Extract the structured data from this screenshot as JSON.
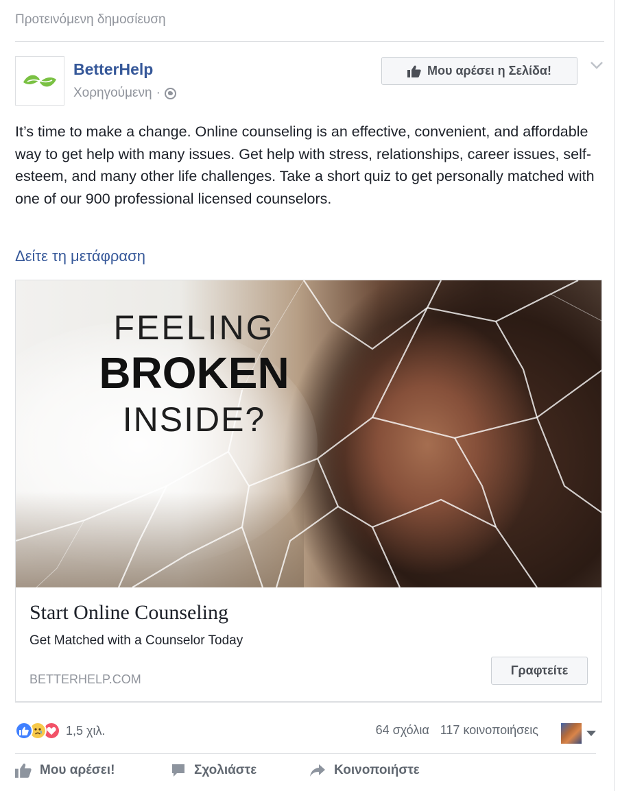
{
  "feed": {
    "suggested_label": "Προτεινόμενη δημοσίευση"
  },
  "post": {
    "page_name": "BetterHelp",
    "sponsored_label": "Χορηγούμενη",
    "separator": "·",
    "like_page_button": "Μου αρέσει η Σελίδα!",
    "body_text": "It’s time to make a change. Online counseling is an effective, convenient, and affordable way to get help with many issues. Get help with stress, relationships, career issues, self-esteem, and many other life challenges. Take a short quiz to get personally matched with one of our 900 professional licensed counselors.",
    "see_translation": "Δείτε τη μετάφραση",
    "brand_color": "#7ac143",
    "link_color": "#365899"
  },
  "ad_card": {
    "image_headline": {
      "line1": "FEELING",
      "line2": "BROKEN",
      "line3": "INSIDE?"
    },
    "title": "Start Online Counseling",
    "subtitle": "Get Matched with a Counselor Today",
    "domain": "BETTERHELP.COM",
    "cta_button": "Γραφτείτε"
  },
  "engagement": {
    "reaction_icons": [
      "like-reaction-icon",
      "sad-reaction-icon",
      "love-reaction-icon"
    ],
    "reaction_count": "1,5 χιλ.",
    "comments": "64 σχόλια",
    "shares": "117 κοινοποιήσεις"
  },
  "actions": {
    "like": "Μου αρέσει!",
    "comment": "Σχολιάστε",
    "share": "Κοινοποιήστε"
  }
}
